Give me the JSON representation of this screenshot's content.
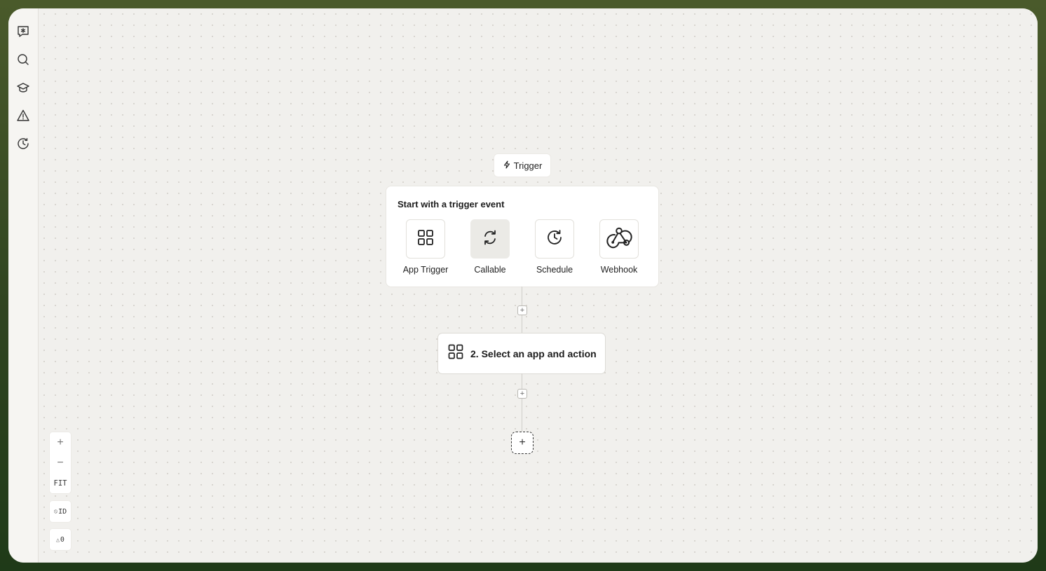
{
  "sidebar": {
    "items": [
      {
        "icon": "ai-chat-icon"
      },
      {
        "icon": "search-icon"
      },
      {
        "icon": "learn-cap-icon"
      },
      {
        "icon": "warning-icon"
      },
      {
        "icon": "history-clock-icon"
      }
    ]
  },
  "trigger": {
    "tag_label": "Trigger",
    "title": "Start with a trigger event",
    "options": [
      {
        "label": "App Trigger",
        "icon": "grid-icon",
        "selected": false
      },
      {
        "label": "Callable",
        "icon": "refresh-icon",
        "selected": true
      },
      {
        "label": "Schedule",
        "icon": "clock-icon",
        "selected": false
      },
      {
        "label": "Webhook",
        "icon": "webhook-icon",
        "selected": false
      }
    ]
  },
  "action": {
    "label": "2. Select an app and action",
    "icon": "grid-icon"
  },
  "controls": {
    "zoom_in": "+",
    "zoom_out": "−",
    "fit": "FIT",
    "id_toggle": "ID",
    "warnings_count": "0"
  },
  "colors": {
    "frame": "#3b4f24",
    "canvas": "#f1f0ed",
    "card": "#ffffff",
    "selected_option": "#ebeae6"
  }
}
